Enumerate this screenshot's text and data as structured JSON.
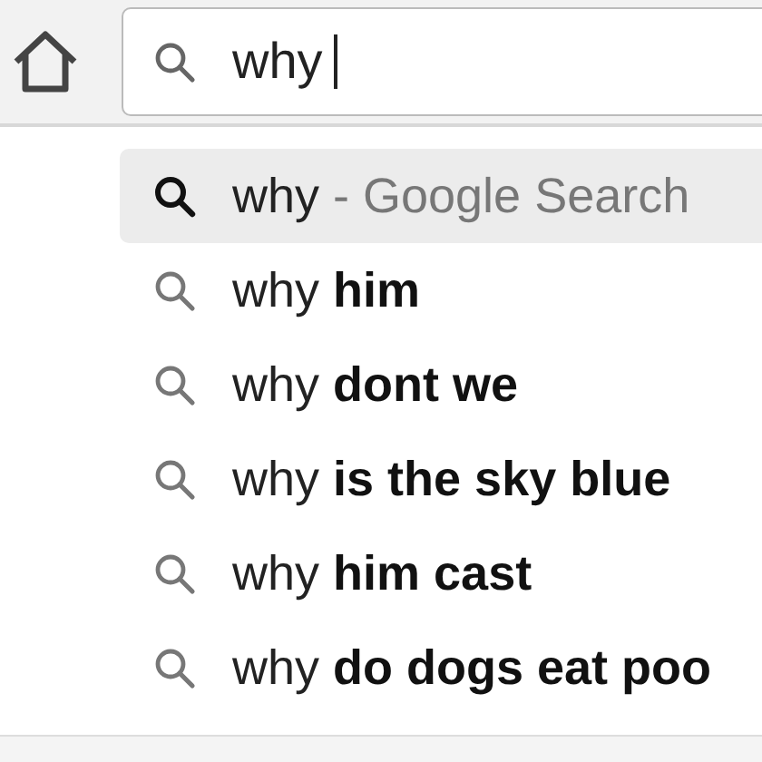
{
  "search": {
    "value": "why"
  },
  "suggestions": [
    {
      "kind": "search",
      "text": "why",
      "hint": "- Google Search",
      "selected": true
    },
    {
      "kind": "query",
      "text": "why **him**",
      "selected": false
    },
    {
      "kind": "query",
      "text": "why **dont we**",
      "selected": false
    },
    {
      "kind": "query",
      "text": "why **is the sky blue**",
      "selected": false
    },
    {
      "kind": "query",
      "text": "why **him cast**",
      "selected": false
    },
    {
      "kind": "query",
      "text": "why **do dogs eat poo**",
      "selected": false
    }
  ]
}
